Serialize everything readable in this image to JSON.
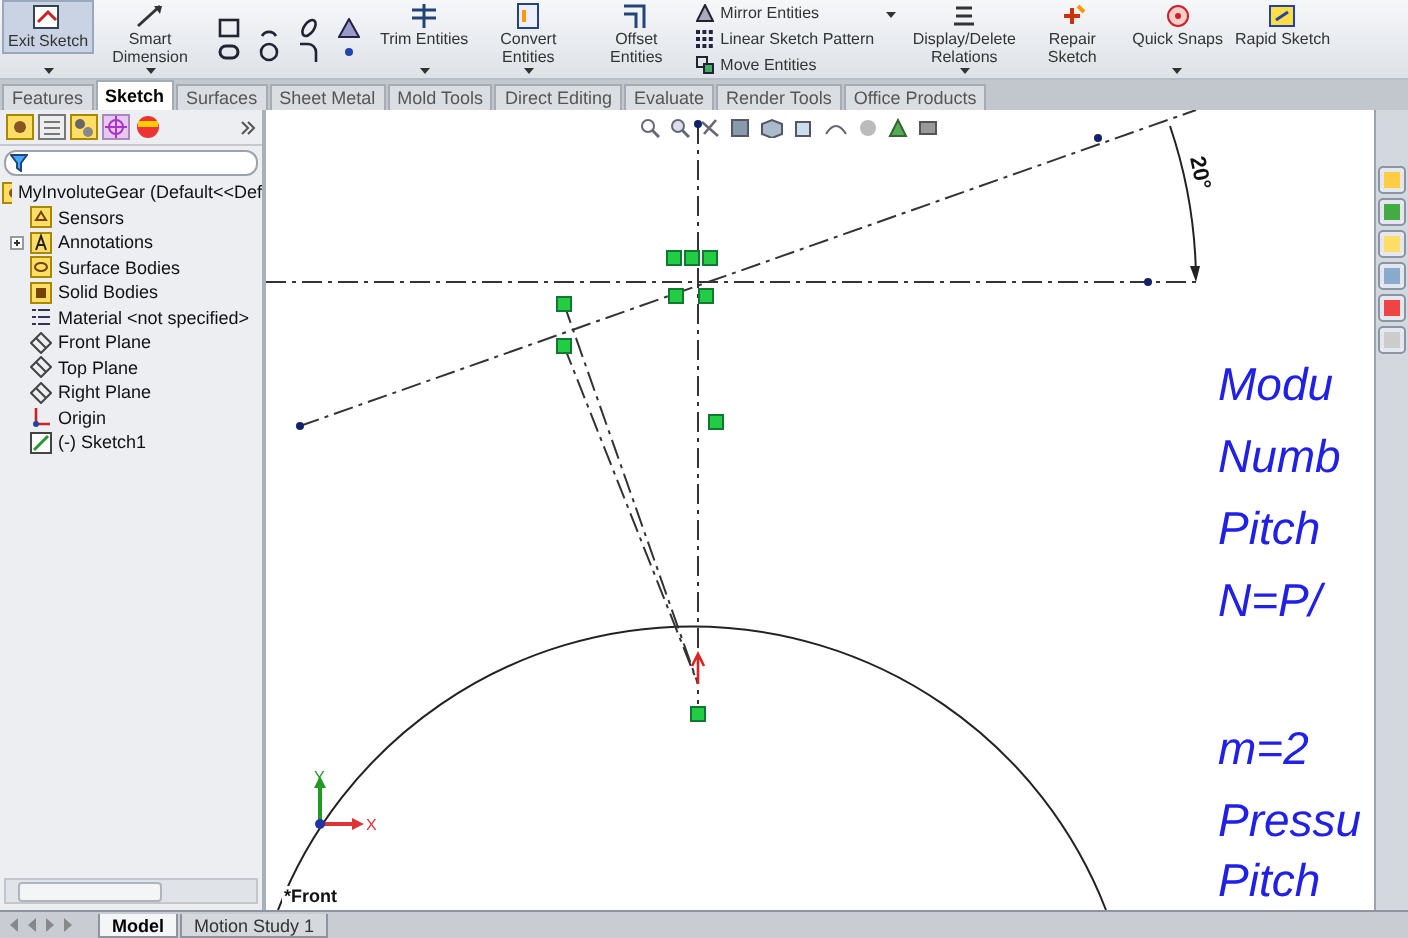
{
  "ribbon": [
    {
      "kind": "large",
      "label": "Exit Sketch",
      "dropdown": true,
      "selected": true
    },
    {
      "kind": "large",
      "label": "Smart Dimension",
      "dropdown": true,
      "selected": false
    },
    {
      "kind": "grid"
    },
    {
      "kind": "large",
      "label": "Trim Entities",
      "dropdown": true,
      "selected": false
    },
    {
      "kind": "large",
      "label": "Convert Entities",
      "dropdown": true,
      "selected": false
    },
    {
      "kind": "large",
      "label": "Offset Entities",
      "dropdown": false,
      "selected": false
    },
    {
      "kind": "stack",
      "labels": [
        "Mirror Entities",
        "Linear Sketch Pattern",
        "Move Entities"
      ]
    },
    {
      "kind": "large",
      "label": "Display/Delete Relations",
      "dropdown": true,
      "selected": false
    },
    {
      "kind": "large",
      "label": "Repair Sketch",
      "dropdown": false,
      "selected": false
    },
    {
      "kind": "large",
      "label": "Quick Snaps",
      "dropdown": true,
      "selected": false
    },
    {
      "kind": "large",
      "label": "Rapid Sketch",
      "dropdown": false,
      "selected": false
    }
  ],
  "command_tabs": [
    {
      "label": "Features",
      "selected": false
    },
    {
      "label": "Sketch",
      "selected": true
    },
    {
      "label": "Surfaces",
      "selected": false
    },
    {
      "label": "Sheet Metal",
      "selected": false
    },
    {
      "label": "Mold Tools",
      "selected": false
    },
    {
      "label": "Direct Editing",
      "selected": false
    },
    {
      "label": "Evaluate",
      "selected": false
    },
    {
      "label": "Render Tools",
      "selected": false
    },
    {
      "label": "Office Products",
      "selected": false
    }
  ],
  "feature_tree": {
    "root": "MyInvoluteGear  (Default<<Def",
    "items": [
      {
        "label": "Sensors",
        "kind": "sensors",
        "expander": false
      },
      {
        "label": "Annotations",
        "kind": "annotations",
        "expander": true
      },
      {
        "label": "Surface Bodies",
        "kind": "surfaces",
        "expander": false
      },
      {
        "label": "Solid Bodies",
        "kind": "solids",
        "expander": false
      },
      {
        "label": "Material <not specified>",
        "kind": "material",
        "expander": false
      },
      {
        "label": "Front Plane",
        "kind": "plane",
        "expander": false
      },
      {
        "label": "Top Plane",
        "kind": "plane",
        "expander": false
      },
      {
        "label": "Right Plane",
        "kind": "plane",
        "expander": false
      },
      {
        "label": "Origin",
        "kind": "origin",
        "expander": false
      },
      {
        "label": "(-) Sketch1",
        "kind": "sketch",
        "expander": false
      }
    ]
  },
  "canvas": {
    "dimension": "20°",
    "view_label": "*Front",
    "axis_x": "X",
    "axis_y": "Y",
    "notes": [
      "Modu",
      "Numb",
      "Pitch",
      "N=P/",
      "m=2",
      "Pressu",
      "Pitch"
    ]
  },
  "bottom_tabs": [
    {
      "label": "Model",
      "selected": true
    },
    {
      "label": "Motion Study 1",
      "selected": false
    }
  ]
}
